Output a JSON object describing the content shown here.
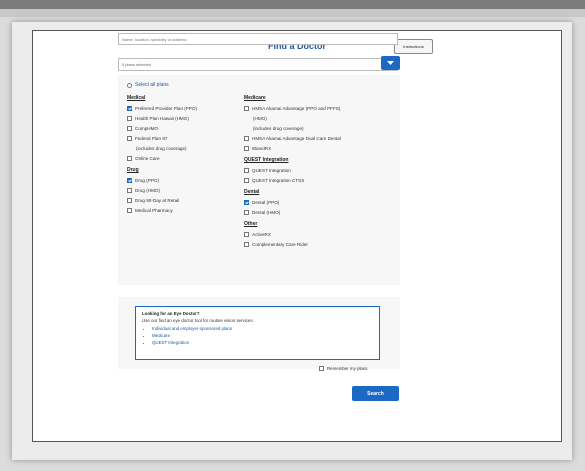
{
  "header": {
    "title": "Find a Doctor",
    "instructions_label": "Instructions"
  },
  "search": {
    "placeholder": "Name, location, specialty or address"
  },
  "plans": {
    "selected_text": "5 plans selected",
    "select_all_label": "Select all plans"
  },
  "columns": {
    "left": [
      {
        "heading": "Medical",
        "items": [
          {
            "label": "Preferred Provider Plan (PPO)",
            "checked": true
          },
          {
            "label": "Health Plan Hawaii (HMO)",
            "checked": false
          },
          {
            "label": "CompHMO",
            "checked": false
          },
          {
            "label": "Federal Plan 87",
            "checked": false,
            "sub": "(includes drug coverage)"
          },
          {
            "label": "Online Care",
            "checked": false
          }
        ]
      },
      {
        "heading": "Drug",
        "items": [
          {
            "label": "Drug (PPO)",
            "checked": true
          },
          {
            "label": "Drug (HMO)",
            "checked": false
          },
          {
            "label": "Drug 90-Day at Retail",
            "checked": false
          },
          {
            "label": "Medical Pharmacy",
            "checked": false
          }
        ]
      }
    ],
    "right": [
      {
        "heading": "Medicare",
        "items": [
          {
            "label": "HMSA Akamai Advantage (PPO and PFFS)",
            "checked": false,
            "sub": "(HMO)"
          },
          {
            "label": "(includes drug coverage)",
            "checked": false,
            "textonly": true
          },
          {
            "label": "HMSA Akamai Advantage Dual Care Dental",
            "checked": false
          },
          {
            "label": "65andRX",
            "checked": false
          }
        ]
      },
      {
        "heading": "QUEST Integration",
        "items": [
          {
            "label": "QUEST Integration",
            "checked": false
          },
          {
            "label": "QUEST Integration CTSS",
            "checked": false
          }
        ]
      },
      {
        "heading": "Dental",
        "items": [
          {
            "label": "Dental (PPO)",
            "checked": true
          },
          {
            "label": "Dental (HMO)",
            "checked": false
          }
        ]
      },
      {
        "heading": "Other",
        "items": [
          {
            "label": "ActiveRX",
            "checked": false
          },
          {
            "label": "Complementary Care Rider",
            "checked": false
          }
        ]
      }
    ]
  },
  "eye_doctor": {
    "title": "Looking for an Eye Doctor?",
    "text": "Use our find an eye doctor tool for routine vision services.",
    "links": [
      "Individual and employer-sponsored plans",
      "Medicare",
      "QUEST Integration"
    ]
  },
  "remember_label": "Remember my plans",
  "search_button_label": "Search",
  "colors": {
    "accent": "#1c69c3",
    "title": "#1f5aa6"
  }
}
